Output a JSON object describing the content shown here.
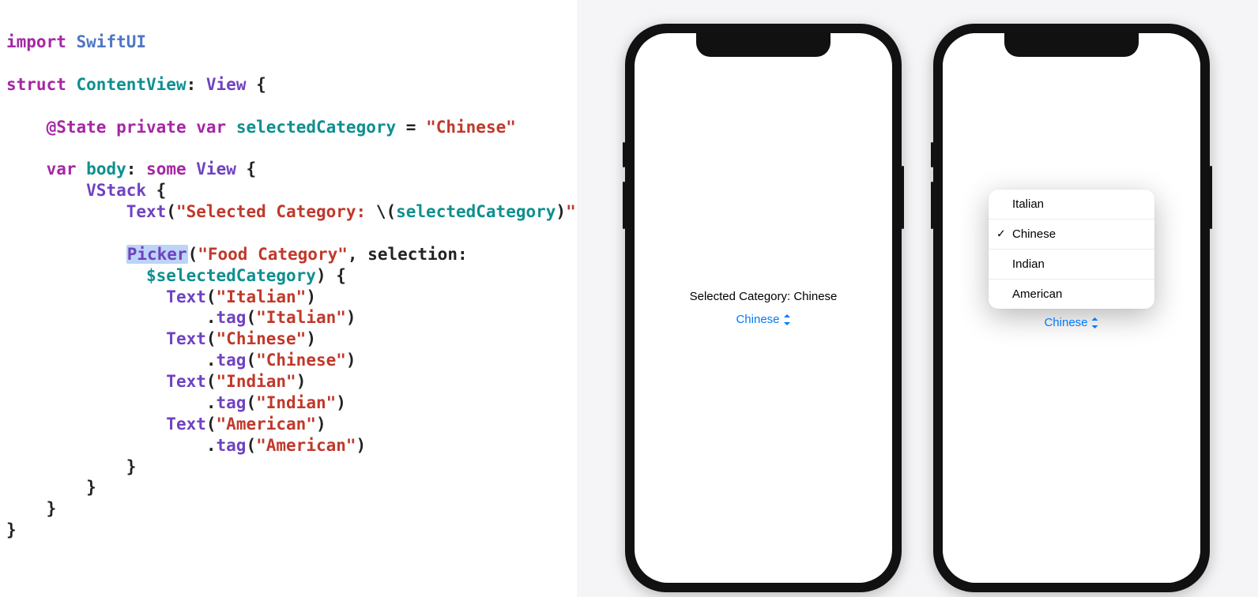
{
  "code": {
    "tokens": [
      [
        [
          "kw",
          "import"
        ],
        [
          "punc",
          " "
        ],
        [
          "type",
          "SwiftUI"
        ]
      ],
      [],
      [
        [
          "kw",
          "struct"
        ],
        [
          "punc",
          " "
        ],
        [
          "decl",
          "ContentView"
        ],
        [
          "punc",
          ": "
        ],
        [
          "prop",
          "View"
        ],
        [
          "punc",
          " {"
        ]
      ],
      [],
      [
        [
          "punc",
          "    "
        ],
        [
          "kw",
          "@State"
        ],
        [
          "punc",
          " "
        ],
        [
          "kw",
          "private"
        ],
        [
          "punc",
          " "
        ],
        [
          "kw",
          "var"
        ],
        [
          "punc",
          " "
        ],
        [
          "decl",
          "selectedCategory"
        ],
        [
          "punc",
          " = "
        ],
        [
          "str",
          "\"Chinese\""
        ]
      ],
      [],
      [
        [
          "punc",
          "    "
        ],
        [
          "kw",
          "var"
        ],
        [
          "punc",
          " "
        ],
        [
          "decl",
          "body"
        ],
        [
          "punc",
          ": "
        ],
        [
          "kw",
          "some"
        ],
        [
          "punc",
          " "
        ],
        [
          "prop",
          "View"
        ],
        [
          "punc",
          " {"
        ]
      ],
      [
        [
          "punc",
          "        "
        ],
        [
          "prop",
          "VStack"
        ],
        [
          "punc",
          " {"
        ]
      ],
      [
        [
          "punc",
          "            "
        ],
        [
          "prop",
          "Text"
        ],
        [
          "punc",
          "("
        ],
        [
          "str",
          "\"Selected Category: "
        ],
        [
          "punc",
          "\\("
        ],
        [
          "interp",
          "selectedCategory"
        ],
        [
          "punc",
          ")"
        ],
        [
          "str",
          "\""
        ],
        [
          "punc",
          ")"
        ]
      ],
      [],
      [
        [
          "punc",
          "            "
        ],
        [
          "prop hl",
          "Picker"
        ],
        [
          "punc",
          "("
        ],
        [
          "str",
          "\"Food Category\""
        ],
        [
          "punc",
          ", selection:"
        ]
      ],
      [
        [
          "punc",
          "              "
        ],
        [
          "decl",
          "$selectedCategory"
        ],
        [
          "punc",
          ") {"
        ]
      ],
      [
        [
          "punc",
          "                "
        ],
        [
          "prop",
          "Text"
        ],
        [
          "punc",
          "("
        ],
        [
          "str",
          "\"Italian\""
        ],
        [
          "punc",
          ")"
        ]
      ],
      [
        [
          "punc",
          "                    ."
        ],
        [
          "prop",
          "tag"
        ],
        [
          "punc",
          "("
        ],
        [
          "str",
          "\"Italian\""
        ],
        [
          "punc",
          ")"
        ]
      ],
      [
        [
          "punc",
          "                "
        ],
        [
          "prop",
          "Text"
        ],
        [
          "punc",
          "("
        ],
        [
          "str",
          "\"Chinese\""
        ],
        [
          "punc",
          ")"
        ]
      ],
      [
        [
          "punc",
          "                    ."
        ],
        [
          "prop",
          "tag"
        ],
        [
          "punc",
          "("
        ],
        [
          "str",
          "\"Chinese\""
        ],
        [
          "punc",
          ")"
        ]
      ],
      [
        [
          "punc",
          "                "
        ],
        [
          "prop",
          "Text"
        ],
        [
          "punc",
          "("
        ],
        [
          "str",
          "\"Indian\""
        ],
        [
          "punc",
          ")"
        ]
      ],
      [
        [
          "punc",
          "                    ."
        ],
        [
          "prop",
          "tag"
        ],
        [
          "punc",
          "("
        ],
        [
          "str",
          "\"Indian\""
        ],
        [
          "punc",
          ")"
        ]
      ],
      [
        [
          "punc",
          "                "
        ],
        [
          "prop",
          "Text"
        ],
        [
          "punc",
          "("
        ],
        [
          "str",
          "\"American\""
        ],
        [
          "punc",
          ")"
        ]
      ],
      [
        [
          "punc",
          "                    ."
        ],
        [
          "prop",
          "tag"
        ],
        [
          "punc",
          "("
        ],
        [
          "str",
          "\"American\""
        ],
        [
          "punc",
          ")"
        ]
      ],
      [
        [
          "punc",
          "            }"
        ]
      ],
      [
        [
          "punc",
          "        }"
        ]
      ],
      [
        [
          "punc",
          "    }"
        ]
      ],
      [
        [
          "punc",
          "}"
        ]
      ]
    ]
  },
  "preview": {
    "selectedLabel": "Selected Category: Chinese",
    "pickerValue": "Chinese",
    "menu": {
      "items": [
        {
          "label": "Italian",
          "checked": false
        },
        {
          "label": "Chinese",
          "checked": true
        },
        {
          "label": "Indian",
          "checked": false
        },
        {
          "label": "American",
          "checked": false
        }
      ]
    }
  }
}
